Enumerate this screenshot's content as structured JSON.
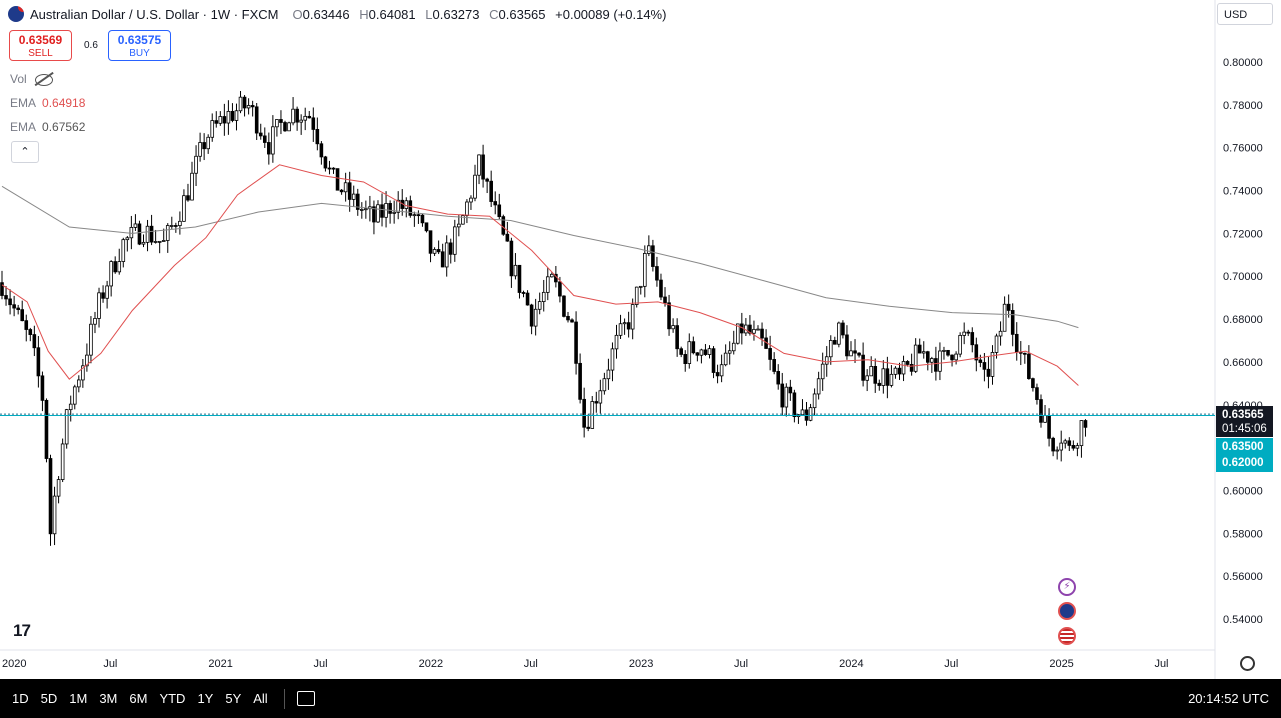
{
  "header": {
    "title": "Australian Dollar / U.S. Dollar · 1W · FXCM",
    "o_label": "O",
    "o": "0.63446",
    "h_label": "H",
    "h": "0.64081",
    "l_label": "L",
    "l": "0.63273",
    "c_label": "C",
    "c": "0.63565",
    "change": "+0.00089 (+0.14%)"
  },
  "trade": {
    "sell_price": "0.63569",
    "sell_label": "SELL",
    "spread": "0.6",
    "buy_price": "0.63575",
    "buy_label": "BUY"
  },
  "indicators": {
    "vol_label": "Vol",
    "ema1_label": "EMA",
    "ema1_value": "0.64918",
    "ema1_color": "#e05050",
    "ema2_label": "EMA",
    "ema2_value": "0.67562",
    "ema2_color": "#888888",
    "collapse_glyph": "⌃"
  },
  "currency": "USD",
  "price_labels": {
    "last": "0.63565",
    "countdown": "01:45:06",
    "level1": "0.63500",
    "level2": "0.62000",
    "last_color": "#131722",
    "level_color": "#00acc1"
  },
  "chart_data": {
    "type": "candlestick",
    "y_ticks": [
      "0.80000",
      "0.78000",
      "0.76000",
      "0.74000",
      "0.72000",
      "0.70000",
      "0.68000",
      "0.66000",
      "0.64000",
      "0.62000",
      "0.60000",
      "0.58000",
      "0.56000",
      "0.54000"
    ],
    "ylim": [
      0.528,
      0.81
    ],
    "x_tick_labels": [
      "2020",
      "Jul",
      "2021",
      "Jul",
      "2022",
      "Jul",
      "2023",
      "Jul",
      "2024",
      "Jul",
      "2025",
      "Jul"
    ],
    "horizontal_lines": [
      0.63565,
      0.635
    ],
    "ema_fast_series": [
      [
        2019.98,
        0.696
      ],
      [
        2020.1,
        0.688
      ],
      [
        2020.2,
        0.665
      ],
      [
        2020.3,
        0.652
      ],
      [
        2020.45,
        0.664
      ],
      [
        2020.6,
        0.684
      ],
      [
        2020.8,
        0.705
      ],
      [
        2020.95,
        0.718
      ],
      [
        2021.1,
        0.738
      ],
      [
        2021.3,
        0.752
      ],
      [
        2021.5,
        0.747
      ],
      [
        2021.7,
        0.744
      ],
      [
        2021.9,
        0.733
      ],
      [
        2022.1,
        0.729
      ],
      [
        2022.3,
        0.728
      ],
      [
        2022.5,
        0.712
      ],
      [
        2022.7,
        0.691
      ],
      [
        2022.9,
        0.687
      ],
      [
        2023.1,
        0.688
      ],
      [
        2023.3,
        0.683
      ],
      [
        2023.5,
        0.676
      ],
      [
        2023.7,
        0.664
      ],
      [
        2023.9,
        0.66
      ],
      [
        2024.1,
        0.661
      ],
      [
        2024.3,
        0.658
      ],
      [
        2024.5,
        0.66
      ],
      [
        2024.7,
        0.663
      ],
      [
        2024.85,
        0.665
      ],
      [
        2025.0,
        0.658
      ],
      [
        2025.1,
        0.649
      ]
    ],
    "ema_slow_series": [
      [
        2019.98,
        0.742
      ],
      [
        2020.3,
        0.723
      ],
      [
        2020.6,
        0.72
      ],
      [
        2020.9,
        0.723
      ],
      [
        2021.2,
        0.73
      ],
      [
        2021.5,
        0.734
      ],
      [
        2021.8,
        0.731
      ],
      [
        2022.1,
        0.728
      ],
      [
        2022.4,
        0.726
      ],
      [
        2022.7,
        0.719
      ],
      [
        2023.0,
        0.713
      ],
      [
        2023.3,
        0.706
      ],
      [
        2023.6,
        0.698
      ],
      [
        2023.9,
        0.69
      ],
      [
        2024.2,
        0.686
      ],
      [
        2024.5,
        0.683
      ],
      [
        2024.8,
        0.682
      ],
      [
        2025.0,
        0.679
      ],
      [
        2025.1,
        0.676
      ]
    ],
    "price_path": [
      [
        2019.98,
        0.697
      ],
      [
        2020.05,
        0.682
      ],
      [
        2020.12,
        0.668
      ],
      [
        2020.18,
        0.64
      ],
      [
        2020.21,
        0.58
      ],
      [
        2020.24,
        0.605
      ],
      [
        2020.3,
        0.64
      ],
      [
        2020.38,
        0.665
      ],
      [
        2020.45,
        0.69
      ],
      [
        2020.55,
        0.715
      ],
      [
        2020.65,
        0.722
      ],
      [
        2020.75,
        0.715
      ],
      [
        2020.85,
        0.736
      ],
      [
        2020.95,
        0.765
      ],
      [
        2021.05,
        0.775
      ],
      [
        2021.15,
        0.78
      ],
      [
        2021.25,
        0.762
      ],
      [
        2021.35,
        0.777
      ],
      [
        2021.45,
        0.775
      ],
      [
        2021.55,
        0.745
      ],
      [
        2021.65,
        0.735
      ],
      [
        2021.75,
        0.726
      ],
      [
        2021.85,
        0.735
      ],
      [
        2021.95,
        0.727
      ],
      [
        2022.05,
        0.705
      ],
      [
        2022.15,
        0.72
      ],
      [
        2022.25,
        0.752
      ],
      [
        2022.3,
        0.737
      ],
      [
        2022.4,
        0.706
      ],
      [
        2022.5,
        0.682
      ],
      [
        2022.6,
        0.698
      ],
      [
        2022.7,
        0.675
      ],
      [
        2022.75,
        0.63
      ],
      [
        2022.8,
        0.643
      ],
      [
        2022.9,
        0.668
      ],
      [
        2022.98,
        0.683
      ],
      [
        2023.05,
        0.712
      ],
      [
        2023.12,
        0.69
      ],
      [
        2023.2,
        0.662
      ],
      [
        2023.3,
        0.668
      ],
      [
        2023.4,
        0.655
      ],
      [
        2023.5,
        0.676
      ],
      [
        2023.6,
        0.668
      ],
      [
        2023.68,
        0.646
      ],
      [
        2023.75,
        0.638
      ],
      [
        2023.8,
        0.633
      ],
      [
        2023.85,
        0.648
      ],
      [
        2023.95,
        0.676
      ],
      [
        2024.05,
        0.658
      ],
      [
        2024.15,
        0.654
      ],
      [
        2024.25,
        0.652
      ],
      [
        2024.35,
        0.665
      ],
      [
        2024.45,
        0.66
      ],
      [
        2024.55,
        0.672
      ],
      [
        2024.6,
        0.667
      ],
      [
        2024.65,
        0.65
      ],
      [
        2024.72,
        0.67
      ],
      [
        2024.76,
        0.69
      ],
      [
        2024.82,
        0.665
      ],
      [
        2024.9,
        0.645
      ],
      [
        2024.97,
        0.622
      ],
      [
        2025.02,
        0.626
      ],
      [
        2025.06,
        0.618
      ],
      [
        2025.1,
        0.628
      ],
      [
        2025.14,
        0.6356
      ]
    ]
  },
  "icons": [
    "lightning-icon",
    "australia-flag-icon",
    "us-flag-icon"
  ],
  "bottom_bar": {
    "ranges": [
      "1D",
      "5D",
      "1M",
      "3M",
      "6M",
      "YTD",
      "1Y",
      "5Y",
      "All"
    ],
    "clock": "20:14:52 UTC"
  }
}
